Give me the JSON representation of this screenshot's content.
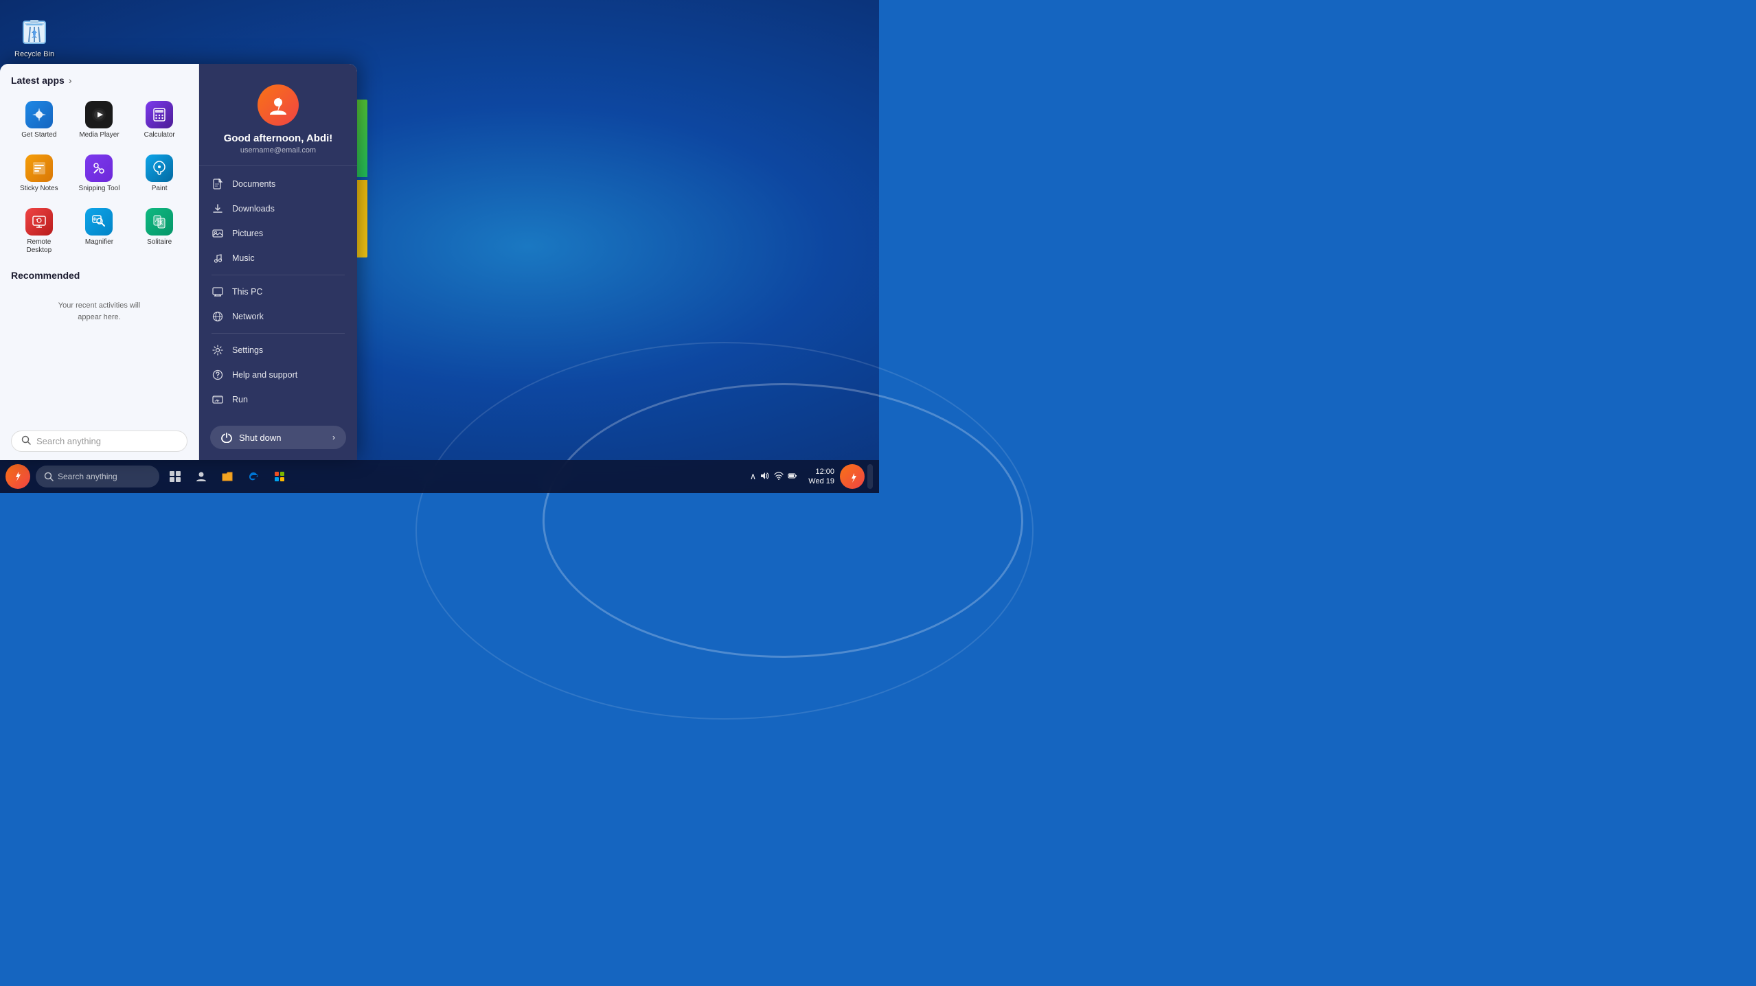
{
  "desktop": {
    "recycle_bin_label": "Recycle Bin"
  },
  "start_menu": {
    "left": {
      "latest_apps_title": "Latest apps",
      "apps": [
        {
          "id": "get-started",
          "label": "Get Started",
          "icon_class": "icon-get-started",
          "symbol": "🏠"
        },
        {
          "id": "media-player",
          "label": "Media Player",
          "icon_class": "icon-media-player",
          "symbol": "▶"
        },
        {
          "id": "calculator",
          "label": "Calculator",
          "icon_class": "icon-calculator",
          "symbol": "🖩"
        },
        {
          "id": "sticky-notes",
          "label": "Sticky Notes",
          "icon_class": "icon-sticky-notes",
          "symbol": "📝"
        },
        {
          "id": "snipping-tool",
          "label": "Snipping Tool",
          "icon_class": "icon-snipping",
          "symbol": "✂"
        },
        {
          "id": "paint",
          "label": "Paint",
          "icon_class": "icon-paint",
          "symbol": "🎨"
        },
        {
          "id": "remote-desktop",
          "label": "Remote Desktop",
          "icon_class": "icon-remote",
          "symbol": "🖥"
        },
        {
          "id": "magnifier",
          "label": "Magnifier",
          "icon_class": "icon-magnifier",
          "symbol": "🔍"
        },
        {
          "id": "solitaire",
          "label": "Solitaire",
          "icon_class": "icon-solitaire",
          "symbol": "🃏"
        }
      ],
      "recommended_title": "Recommended",
      "recommended_empty": "Your recent activities will\nappear here.",
      "search_placeholder": "Search anything"
    },
    "right": {
      "user_greeting": "Good afternoon, Abdi!",
      "user_email": "username@email.com",
      "menu_items": [
        {
          "id": "documents",
          "label": "Documents",
          "icon": "📄"
        },
        {
          "id": "downloads",
          "label": "Downloads",
          "icon": "⬇"
        },
        {
          "id": "pictures",
          "label": "Pictures",
          "icon": "🖼"
        },
        {
          "id": "music",
          "label": "Music",
          "icon": "🎵"
        },
        {
          "id": "this-pc",
          "label": "This PC",
          "icon": "💻"
        },
        {
          "id": "network",
          "label": "Network",
          "icon": "🌐"
        },
        {
          "id": "settings",
          "label": "Settings",
          "icon": "⚙"
        },
        {
          "id": "help",
          "label": "Help and support",
          "icon": "❓"
        },
        {
          "id": "run",
          "label": "Run",
          "icon": "▶"
        }
      ],
      "shutdown_label": "Shut down"
    }
  },
  "taskbar": {
    "search_placeholder": "Search anything",
    "clock_date": "Wed 19",
    "clock_time": "12:00"
  }
}
